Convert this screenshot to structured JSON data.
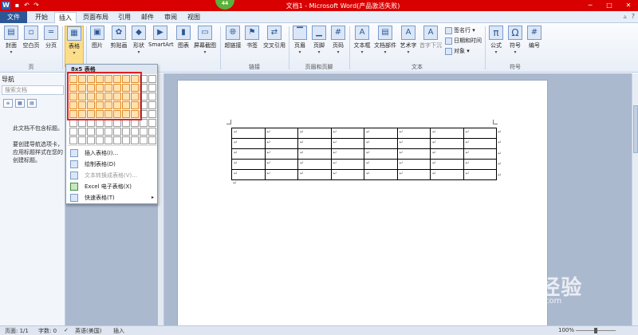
{
  "window": {
    "title": "文档1 - Microsoft Word(产品激活失败)",
    "badge": "44",
    "qa_icons": [
      "save-icon",
      "undo-icon",
      "redo-icon"
    ]
  },
  "tabs": [
    {
      "label": "文件"
    },
    {
      "label": "开始"
    },
    {
      "label": "插入"
    },
    {
      "label": "页面布局"
    },
    {
      "label": "引用"
    },
    {
      "label": "邮件"
    },
    {
      "label": "审阅"
    },
    {
      "label": "视图"
    }
  ],
  "ribbon": {
    "buttons": [
      {
        "label": "封面",
        "icon": "cover-icon"
      },
      {
        "label": "空白页",
        "icon": "blank-page-icon"
      },
      {
        "label": "分页",
        "icon": "page-break-icon"
      },
      {
        "label": "表格",
        "icon": "table-icon"
      },
      {
        "label": "图片",
        "icon": "picture-icon"
      },
      {
        "label": "剪贴画",
        "icon": "clipart-icon"
      },
      {
        "label": "形状",
        "icon": "shapes-icon"
      },
      {
        "label": "SmartArt",
        "icon": "smartart-icon"
      },
      {
        "label": "图表",
        "icon": "chart-icon"
      },
      {
        "label": "屏幕截图",
        "icon": "screenshot-icon"
      },
      {
        "label": "超链接",
        "icon": "hyperlink-icon"
      },
      {
        "label": "书签",
        "icon": "bookmark-icon"
      },
      {
        "label": "交叉引用",
        "icon": "crossref-icon"
      },
      {
        "label": "页眉",
        "icon": "header-icon"
      },
      {
        "label": "页脚",
        "icon": "footer-icon"
      },
      {
        "label": "页码",
        "icon": "page-number-icon"
      },
      {
        "label": "文本框",
        "icon": "textbox-icon"
      },
      {
        "label": "文档部件",
        "icon": "quickparts-icon"
      },
      {
        "label": "艺术字",
        "icon": "wordart-icon"
      },
      {
        "label": "首字下沉",
        "icon": "dropcap-icon"
      },
      {
        "label": "公式",
        "icon": "equation-icon"
      },
      {
        "label": "符号",
        "icon": "symbol-icon"
      },
      {
        "label": "编号",
        "icon": "numbering-icon"
      }
    ],
    "small_buttons": [
      {
        "label": "签名行 ▾"
      },
      {
        "label": "日期和时间"
      },
      {
        "label": "对象 ▾"
      }
    ],
    "groups": [
      {
        "label": "页"
      },
      {
        "label": "链接"
      },
      {
        "label": "页眉和页脚"
      },
      {
        "label": "文本"
      },
      {
        "label": "符号"
      }
    ]
  },
  "nav": {
    "title": "导航",
    "search_placeholder": "搜索文档",
    "tabs": [
      "browse-headings-icon",
      "browse-pages-icon",
      "browse-results-icon"
    ],
    "messages": [
      "此文档不包含标题。",
      "要创建导航选项卡，",
      "应用标题样式在您的",
      "创建标题。"
    ]
  },
  "dropdown": {
    "header": "8x5 表格",
    "grid": {
      "cols": 10,
      "rows": 8,
      "sel_cols": 8,
      "sel_rows": 5
    },
    "items": [
      {
        "label": "插入表格(I)...",
        "icon": "insert-table-icon",
        "enabled": true
      },
      {
        "label": "绘制表格(D)",
        "icon": "draw-table-icon",
        "enabled": true
      },
      {
        "label": "文本转换成表格(V)...",
        "icon": "convert-text-icon",
        "enabled": false
      },
      {
        "label": "Excel 电子表格(X)",
        "icon": "excel-icon",
        "enabled": true
      },
      {
        "label": "快速表格(T)",
        "icon": "quick-table-icon",
        "enabled": true,
        "submenu": "▸"
      }
    ]
  },
  "document": {
    "table": {
      "rows": 5,
      "cols": 8,
      "cell_mark": "↵"
    }
  },
  "status": {
    "page": "页面: 1/1",
    "words": "字数: 0",
    "language": "英语(美国)",
    "mode": "插入",
    "zoom": "100%"
  },
  "watermark": {
    "brand": "Bai度经验",
    "url": "jingyan.baidu.com"
  }
}
